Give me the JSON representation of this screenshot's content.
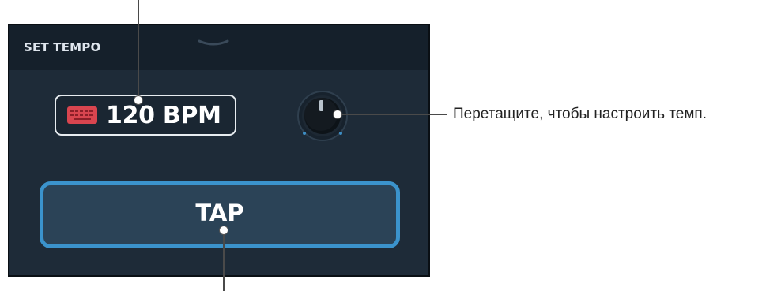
{
  "panel": {
    "title": "SET TEMPO",
    "collapse_icon": "chevron-down-icon"
  },
  "bpm_display": {
    "icon": "keyboard-icon",
    "value": "120 BPM"
  },
  "tempo_knob": {
    "icon": "knob-icon"
  },
  "tap_button": {
    "label": "TAP"
  },
  "callouts": {
    "knob": "Перетащите, чтобы настроить темп."
  },
  "colors": {
    "panel_bg": "#1e2b38",
    "header_bg": "#15202b",
    "tap_border": "#3b93cc",
    "tap_bg": "#2b4357",
    "keyboard_icon": "#d9454f"
  }
}
